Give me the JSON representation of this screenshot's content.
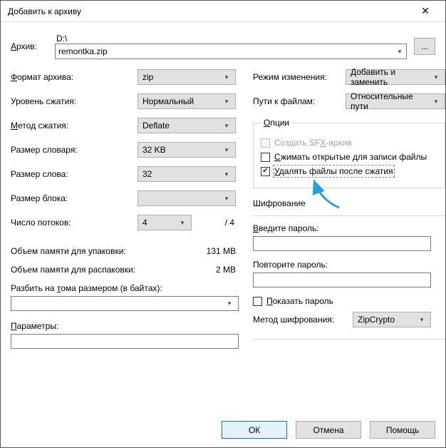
{
  "title": "Добавить к архиву",
  "archive": {
    "label": "Архив:",
    "drive": "D:\\",
    "name": "remontka.zip",
    "browse": "..."
  },
  "left": {
    "format_label": "Формат архива:",
    "format_value": "zip",
    "level_label": "Уровень сжатия:",
    "level_value": "Нормальный",
    "method_label": "Метод сжатия:",
    "method_value": "Deflate",
    "dict_label": "Размер словаря:",
    "dict_value": "32 KB",
    "word_label": "Размер слова:",
    "word_value": "32",
    "block_label": "Размер блока:",
    "block_value": "",
    "threads_label": "Число потоков:",
    "threads_value": "4",
    "threads_total": "/ 4",
    "mem_pack_label": "Объем памяти для упаковки:",
    "mem_pack_value": "131 MB",
    "mem_unpack_label": "Объем памяти для распаковки:",
    "mem_unpack_value": "2 MB",
    "split_label": "Разбить на тома размером (в байтах):",
    "params_label": "Параметры:"
  },
  "right": {
    "update_label": "Режим изменения:",
    "update_value": "Добавить и заменить",
    "paths_label": "Пути к файлам:",
    "paths_value": "Относительные пути",
    "options_legend": "Опции",
    "opt_sfx": "Создать SFX-архив",
    "opt_shared": "Сжимать открытые для записи файлы",
    "opt_delete": "Удалять файлы после сжатия",
    "enc_title": "Шифрование",
    "pw_label": "Введите пароль:",
    "pw2_label": "Повторите пароль:",
    "show_pw": "Показать пароль",
    "enc_method_label": "Метод шифрования:",
    "enc_method_value": "ZipCrypto"
  },
  "buttons": {
    "ok": "ОК",
    "cancel": "Отмена",
    "help": "Помощь"
  }
}
